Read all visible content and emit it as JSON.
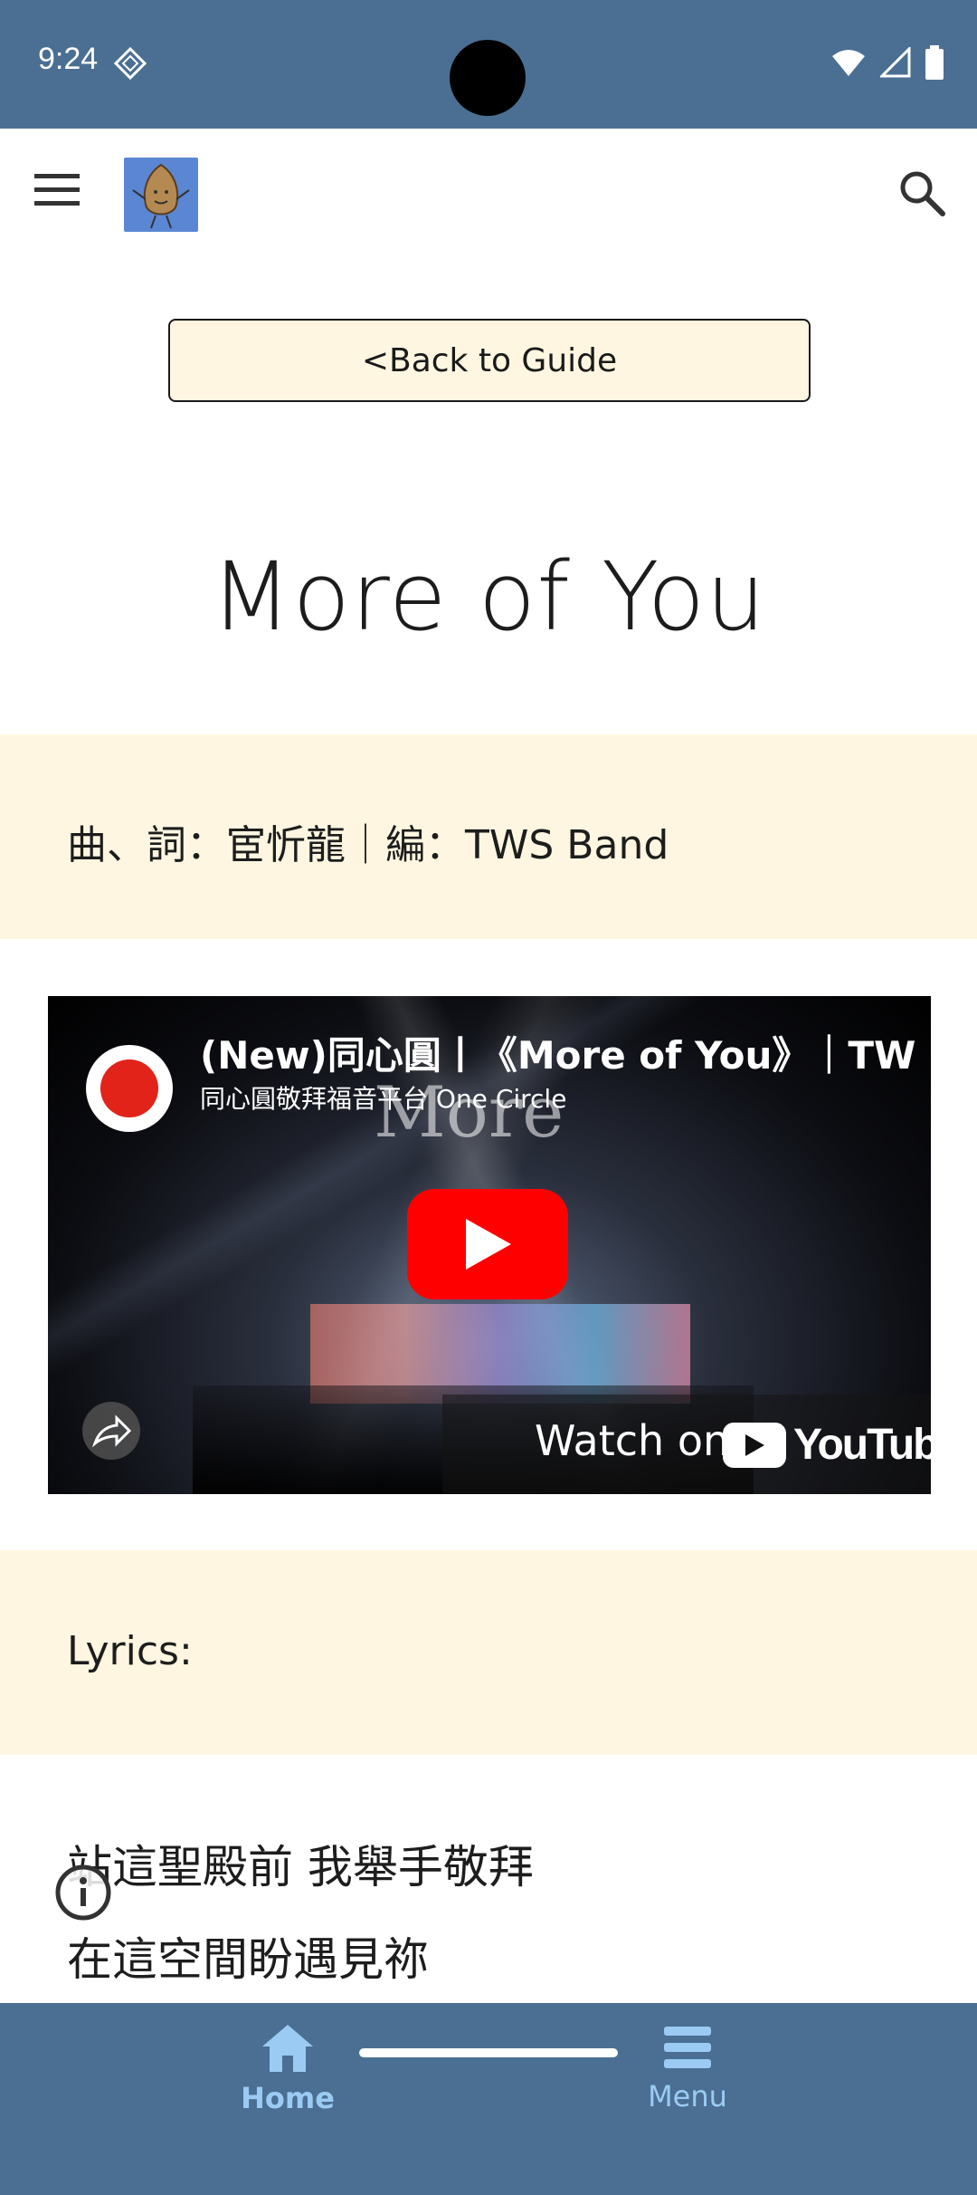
{
  "status_bar": {
    "time": "9:24",
    "icons": [
      "diamond-icon",
      "wifi-icon",
      "signal-icon",
      "battery-icon"
    ]
  },
  "app_bar": {
    "menu_icon": "menu-icon",
    "search_icon": "search-icon"
  },
  "back_button": {
    "label": "<Back to Guide"
  },
  "page": {
    "title": "More of You",
    "credits": "曲、詞：宦忻龍｜編：TWS Band"
  },
  "video": {
    "title": "(New)同心圓丨《More of You》｜TW",
    "channel": "同心圓敬拜福音平台 One Circle",
    "overlay_text": "More",
    "watch_on": "Watch on",
    "youtube": "YouTube"
  },
  "lyrics": {
    "label": "Lyrics:",
    "lines": [
      "站這聖殿前 我舉手敬拜",
      "在這空間盼遇見祢"
    ]
  },
  "bottom_nav": {
    "items": [
      {
        "label": "Home",
        "icon": "home-icon",
        "active": true
      },
      {
        "label": "Menu",
        "icon": "menu-icon",
        "active": false
      }
    ]
  },
  "colors": {
    "primary": "#4a6f93",
    "band": "#fff6e1",
    "nav_text": "#9bcbf3",
    "youtube_red": "#ff0000"
  }
}
